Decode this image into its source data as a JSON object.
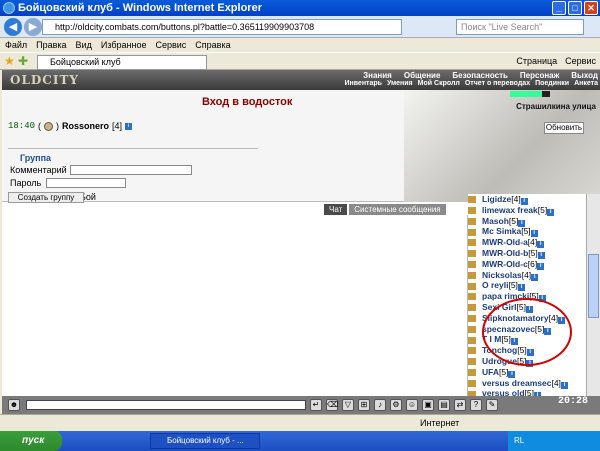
{
  "window": {
    "title": "Бойцовский клуб - Windows Internet Explorer"
  },
  "browser": {
    "url": "http://oldcity.combats.com/buttons.pl?battle=0.365119909903708",
    "search_placeholder": "Поиск \"Live Search\"",
    "menu": [
      "Файл",
      "Правка",
      "Вид",
      "Избранное",
      "Сервис",
      "Справка"
    ],
    "tab_title": "Бойцовский клуб",
    "tools": [
      "Страница",
      "Сервис"
    ]
  },
  "game": {
    "logo": "OLDCITY",
    "nav_top": [
      "Знания",
      "Общение",
      "Безопасность",
      "Персонаж",
      "Выход"
    ],
    "nav_bottom": [
      "Инвентарь",
      "Умения",
      "Мой Скролл",
      "Отчет о переводах",
      "Поединки",
      "Анкета"
    ],
    "room_title": "Вход в водосток",
    "time": "18:40",
    "player_name": "Rossonero",
    "player_level": "[4]",
    "location": "Страшилкина улица",
    "street_level": 0.8,
    "refresh_label": "Обновить",
    "group_title": "Группа",
    "comment_label": "Комментарий",
    "password_label": "Пароль",
    "quick_fight_label": "Быстрый Бой",
    "create_group_label": "Создать группу",
    "chat_tabs": [
      "Чат",
      "Системные сообщения"
    ],
    "players": [
      {
        "name": "Ligidze",
        "level": "[4]"
      },
      {
        "name": "limewax freak",
        "level": "[5]"
      },
      {
        "name": "Masoh",
        "level": "[5]"
      },
      {
        "name": "Mc Simka",
        "level": "[5]"
      },
      {
        "name": "MWR-Old-a",
        "level": "[4]"
      },
      {
        "name": "MWR-Old-b",
        "level": "[5]"
      },
      {
        "name": "MWR-Old-c",
        "level": "[6]"
      },
      {
        "name": "Nicksolas",
        "level": "[4]"
      },
      {
        "name": "O reyli",
        "level": "[5]"
      },
      {
        "name": "papa rimcki",
        "level": "[5]"
      },
      {
        "name": "Sexi Girl",
        "level": "[5]"
      },
      {
        "name": "Slipknotamatory",
        "level": "[4]"
      },
      {
        "name": "specnazovec",
        "level": "[5]"
      },
      {
        "name": "T I M",
        "level": "[5]"
      },
      {
        "name": "Tonchog",
        "level": "[5]"
      },
      {
        "name": "Udrogue",
        "level": "[5]"
      },
      {
        "name": "UFA",
        "level": "[5]"
      },
      {
        "name": "versus dreamsec",
        "level": "[4]"
      },
      {
        "name": "versus old",
        "level": "[5]"
      }
    ],
    "clock2": "20:28"
  },
  "status": {
    "zone": "Интернет"
  },
  "taskbar": {
    "start": "пуск",
    "task": "Бойцовский клуб - ...",
    "tray": "RL"
  }
}
